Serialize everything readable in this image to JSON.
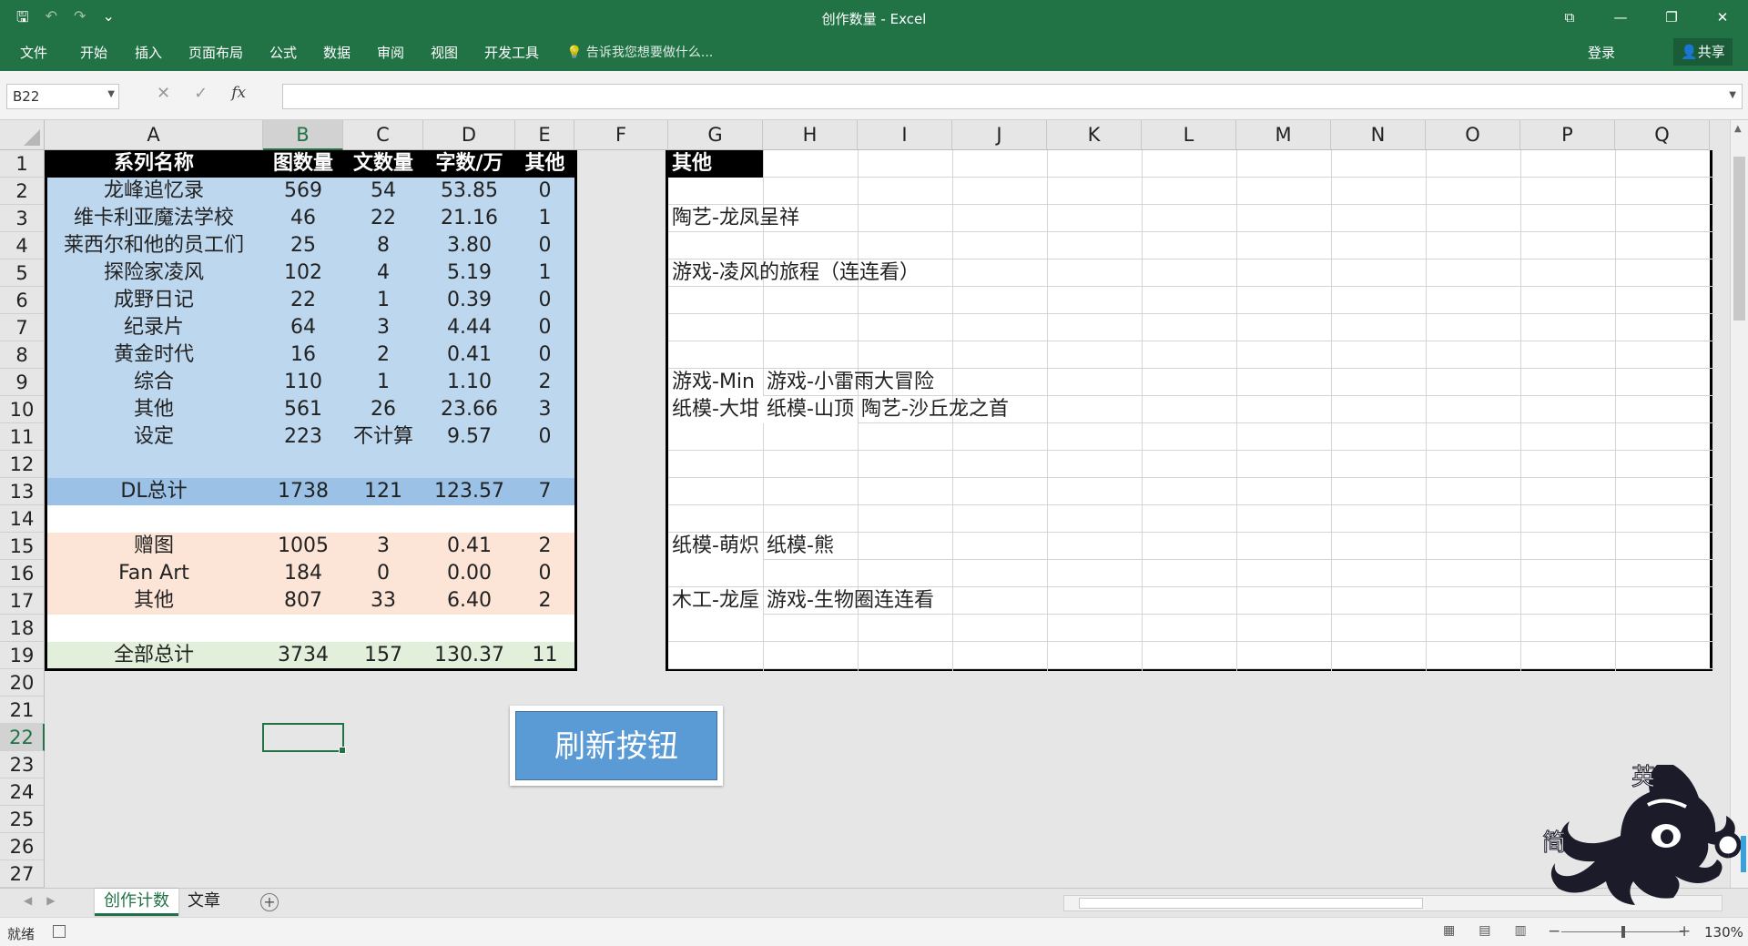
{
  "window": {
    "title": "创作数量 - Excel",
    "restore_icon": "⧉"
  },
  "qat": {
    "save": "🖫",
    "undo": "↶",
    "redo": "↷",
    "more": "⌄"
  },
  "ribbon": {
    "tabs": [
      "文件",
      "开始",
      "插入",
      "页面布局",
      "公式",
      "数据",
      "审阅",
      "视图",
      "开发工具"
    ],
    "tell_me": "告诉我您想要做什么...",
    "login": "登录",
    "share": "共享"
  },
  "formula_bar": {
    "name_box": "B22",
    "cancel": "✕",
    "enter": "✓",
    "fx": "fx",
    "content": ""
  },
  "columns": [
    "A",
    "B",
    "C",
    "D",
    "E",
    "F",
    "G",
    "H",
    "I",
    "J",
    "K",
    "L",
    "M",
    "N",
    "O",
    "P",
    "Q"
  ],
  "rows": [
    "1",
    "2",
    "3",
    "4",
    "5",
    "6",
    "7",
    "8",
    "9",
    "10",
    "11",
    "12",
    "13",
    "14",
    "15",
    "16",
    "17",
    "18",
    "19",
    "20",
    "21",
    "22",
    "23",
    "24",
    "25",
    "26",
    "27"
  ],
  "selected_cell": {
    "column": "B",
    "row": "22"
  },
  "left_table": {
    "header": [
      "系列名称",
      "图数量",
      "文数量",
      "字数/万",
      "其他"
    ],
    "blue_rows": [
      [
        "龙峰追忆录",
        "569",
        "54",
        "53.85",
        "0"
      ],
      [
        "维卡利亚魔法学校",
        "46",
        "22",
        "21.16",
        "1"
      ],
      [
        "莱西尔和他的员工们",
        "25",
        "8",
        "3.80",
        "0"
      ],
      [
        "探险家凌风",
        "102",
        "4",
        "5.19",
        "1"
      ],
      [
        "成野日记",
        "22",
        "1",
        "0.39",
        "0"
      ],
      [
        "纪录片",
        "64",
        "3",
        "4.44",
        "0"
      ],
      [
        "黄金时代",
        "16",
        "2",
        "0.41",
        "0"
      ],
      [
        "综合",
        "110",
        "1",
        "1.10",
        "2"
      ],
      [
        "其他",
        "561",
        "26",
        "23.66",
        "3"
      ],
      [
        "设定",
        "223",
        "不计算",
        "9.57",
        "0"
      ]
    ],
    "dl_total": [
      "DL总计",
      "1738",
      "121",
      "123.57",
      "7"
    ],
    "peach_rows": [
      [
        "赠图",
        "1005",
        "3",
        "0.41",
        "2"
      ],
      [
        "Fan Art",
        "184",
        "0",
        "0.00",
        "0"
      ],
      [
        "其他",
        "807",
        "33",
        "6.40",
        "2"
      ]
    ],
    "grand_total": [
      "全部总计",
      "3734",
      "157",
      "130.37",
      "11"
    ]
  },
  "right_table": {
    "header": "其他",
    "cells": [
      {
        "row": "3",
        "col": "G",
        "text": "陶艺-龙凤呈祥"
      },
      {
        "row": "5",
        "col": "G",
        "text": "游戏-凌风的旅程（连连看）"
      },
      {
        "row": "9",
        "col": "G",
        "text": "游戏-Min"
      },
      {
        "row": "9",
        "col": "H",
        "text": "游戏-小雷雨大冒险"
      },
      {
        "row": "10",
        "col": "G",
        "text": "纸模-大坩"
      },
      {
        "row": "10",
        "col": "H",
        "text": "纸模-山顶"
      },
      {
        "row": "10",
        "col": "I",
        "text": "陶艺-沙丘龙之首"
      },
      {
        "row": "15",
        "col": "G",
        "text": "纸模-萌炽"
      },
      {
        "row": "15",
        "col": "H",
        "text": "纸模-熊"
      },
      {
        "row": "17",
        "col": "G",
        "text": "木工-龙垕"
      },
      {
        "row": "17",
        "col": "H",
        "text": "游戏-生物圈连连看"
      }
    ]
  },
  "refresh_button": "刷新按钮",
  "sheets": [
    "创作计数",
    "文章"
  ],
  "active_sheet": "创作计数",
  "add_sheet": "+",
  "status": {
    "ready": "就绪",
    "zoom": "130%",
    "zoom_minus": "−",
    "zoom_plus": "+"
  },
  "mascot": {
    "label_top": "英",
    "label_left": "简"
  },
  "colors": {
    "excel_green": "#217346",
    "blue_rows": "#bdd7ee",
    "total_row": "#9bc2e6",
    "peach_rows": "#fce4d6",
    "green_row": "#e2efda",
    "button": "#5b9bd5"
  }
}
